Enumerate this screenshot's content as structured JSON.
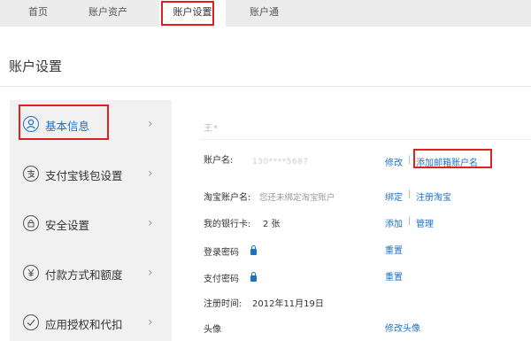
{
  "nav": {
    "items": [
      "首页",
      "账户资产",
      "账户设置",
      "账户通"
    ],
    "active_index": 2
  },
  "page_title": "账户设置",
  "sidebar": {
    "items": [
      {
        "label": "基本信息",
        "icon": "user-icon"
      },
      {
        "label": "支付宝钱包设置",
        "icon": "alipay-wallet-icon"
      },
      {
        "label": "安全设置",
        "icon": "lock-icon"
      },
      {
        "label": "付款方式和额度",
        "icon": "yuan-icon"
      },
      {
        "label": "应用授权和代扣",
        "icon": "check-icon"
      }
    ],
    "active_index": 0,
    "chevron": "›"
  },
  "profile": {
    "name_masked": "王*",
    "rows": {
      "account": {
        "label": "账户名:",
        "value_masked": "130****5687",
        "action1": "修改",
        "action2": "添加邮箱账户名"
      },
      "taobao": {
        "label": "淘宝账户名:",
        "value": "您还未绑定淘宝账户",
        "action1": "绑定",
        "action2": "注册淘宝"
      },
      "bank": {
        "label": "我的银行卡:",
        "value": "2 张",
        "action1": "添加",
        "action2": "管理"
      },
      "login_pwd": {
        "label": "登录密码",
        "action1": "重置"
      },
      "pay_pwd": {
        "label": "支付密码",
        "action1": "重置"
      },
      "register": {
        "label": "注册时间:",
        "value": "2012年11月19日"
      },
      "avatar": {
        "label": "头像",
        "action1": "修改头像"
      }
    },
    "separator": "|"
  },
  "colors": {
    "accent": "#1a73c7",
    "highlight": "#e0201f",
    "nav_bg": "#ececec",
    "sidebar_bg": "#f1f1f1"
  }
}
